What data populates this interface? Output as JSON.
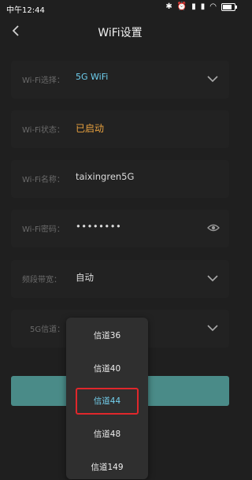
{
  "status_bar": {
    "time": "中午12:44"
  },
  "header": {
    "title": "WiFi设置"
  },
  "rows": [
    {
      "label": "Wi-Fi选择：",
      "value": "5G WiFi"
    },
    {
      "label": "Wi-Fi状态：",
      "value": "已启动"
    },
    {
      "label": "Wi-Fi名称：",
      "value": "taixingren5G"
    },
    {
      "label": "Wi-Fi密码：",
      "value": "••••••••"
    },
    {
      "label": "频段带宽：",
      "value": "自动"
    },
    {
      "label": "5G信道：",
      "value": ""
    }
  ],
  "channel_dropdown": {
    "options": [
      "信道36",
      "信道40",
      "信道44",
      "信道48",
      "信道149"
    ],
    "selected": "信道44"
  },
  "colors": {
    "accent": "#4a8b88",
    "highlight_blue": "#6fd0f0",
    "status_orange": "#e9a23f",
    "selection_red": "#e0272b"
  },
  "icons": [
    "back-chevron-icon",
    "dropdown-chevron-icon",
    "eye-icon"
  ]
}
